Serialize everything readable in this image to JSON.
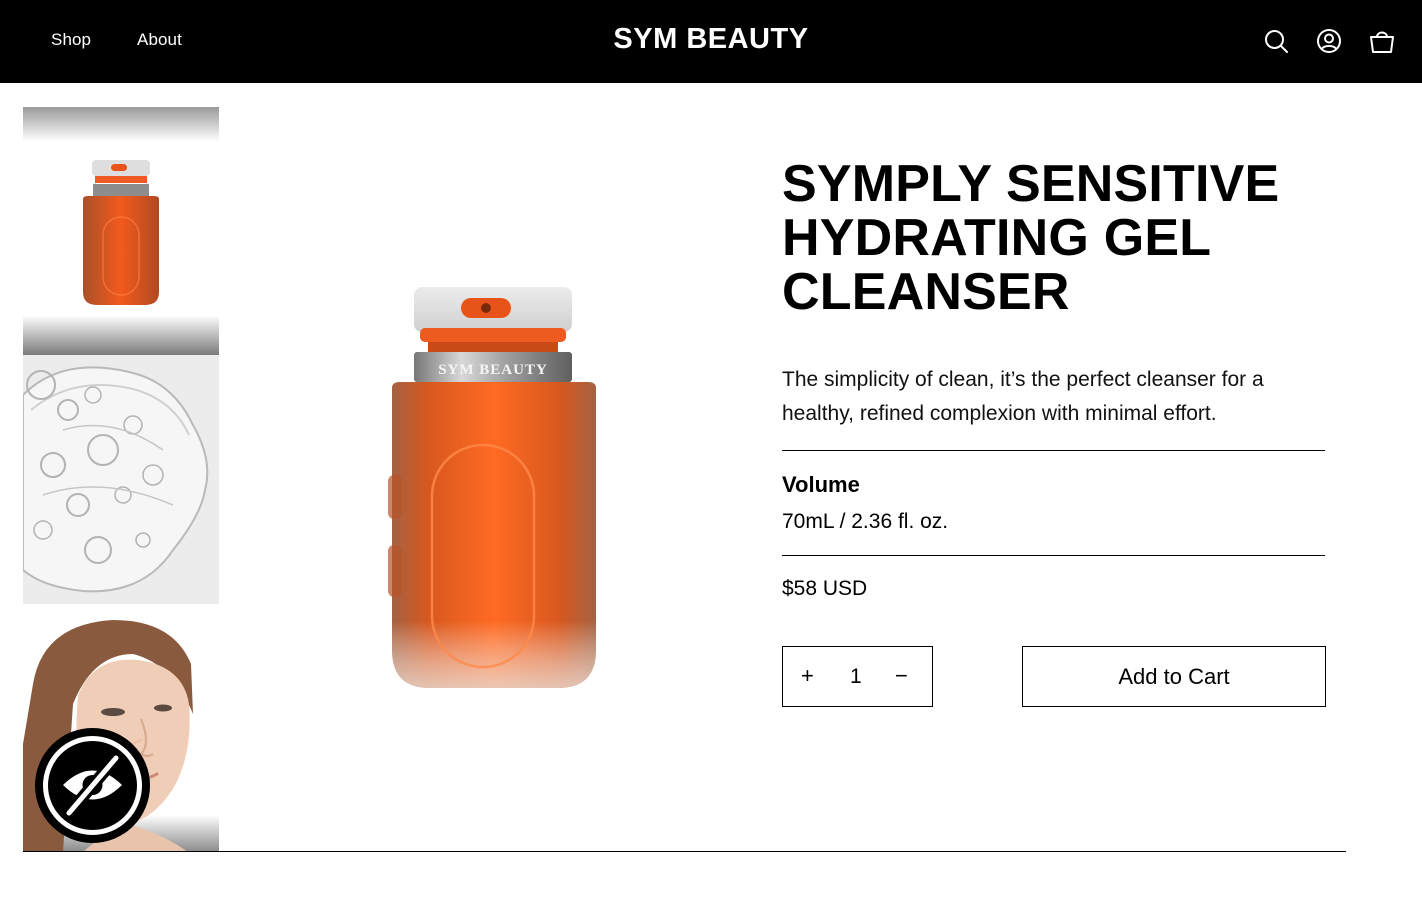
{
  "header": {
    "nav": [
      {
        "label": "Shop"
      },
      {
        "label": "About"
      }
    ],
    "brand": "SYM BEAUTY",
    "icons": [
      "search-icon",
      "account-icon",
      "cart-icon"
    ]
  },
  "gallery": {
    "thumbnails": [
      {
        "name": "product-bottle-thumbnail"
      },
      {
        "name": "gel-texture-thumbnail"
      },
      {
        "name": "model-face-thumbnail"
      }
    ],
    "main_image_brand_text": "SYM BEAUTY"
  },
  "product": {
    "title_lines": [
      "SYMPLY SENSITIVE",
      "HYDRATING GEL",
      "CLEANSER"
    ],
    "description": "The simplicity of clean, it’s the perfect cleanser for a healthy, refined complexion with minimal effort.",
    "volume_label": "Volume",
    "volume_value": "70mL / 2.36 fl. oz.",
    "price": "$58 USD",
    "quantity": {
      "plus": "+",
      "value": "1",
      "minus": "−"
    },
    "add_to_cart": "Add to Cart"
  },
  "accessibility_widget": {
    "icon": "eye-slash-icon"
  },
  "colors": {
    "header_bg": "#000000",
    "bottle_orange": "#f0561a",
    "cap_gray": "#e4e4e4"
  }
}
